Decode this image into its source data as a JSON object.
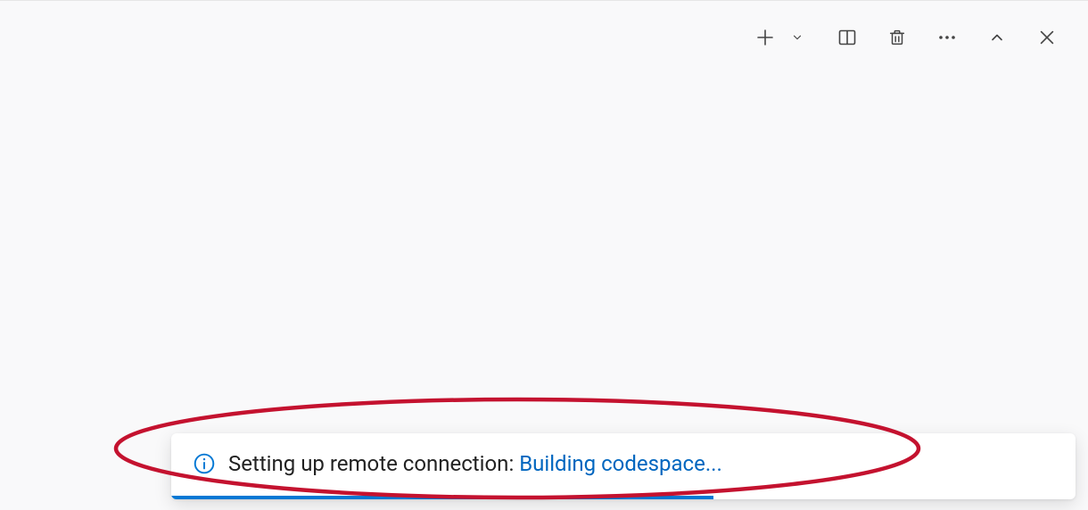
{
  "toolbar": {
    "icons": {
      "new": "plus-icon",
      "new_menu": "chevron-down-icon",
      "split": "split-panel-icon",
      "trash": "trash-icon",
      "more": "ellipsis-icon",
      "collapse": "chevron-up-icon",
      "close": "close-icon"
    }
  },
  "notification": {
    "icon": "info-icon",
    "message_prefix": "Setting up remote connection: ",
    "message_link": "Building codespace...",
    "progress_percent": 60
  },
  "annotation": {
    "shape": "ellipse",
    "stroke": "#c4122f"
  }
}
